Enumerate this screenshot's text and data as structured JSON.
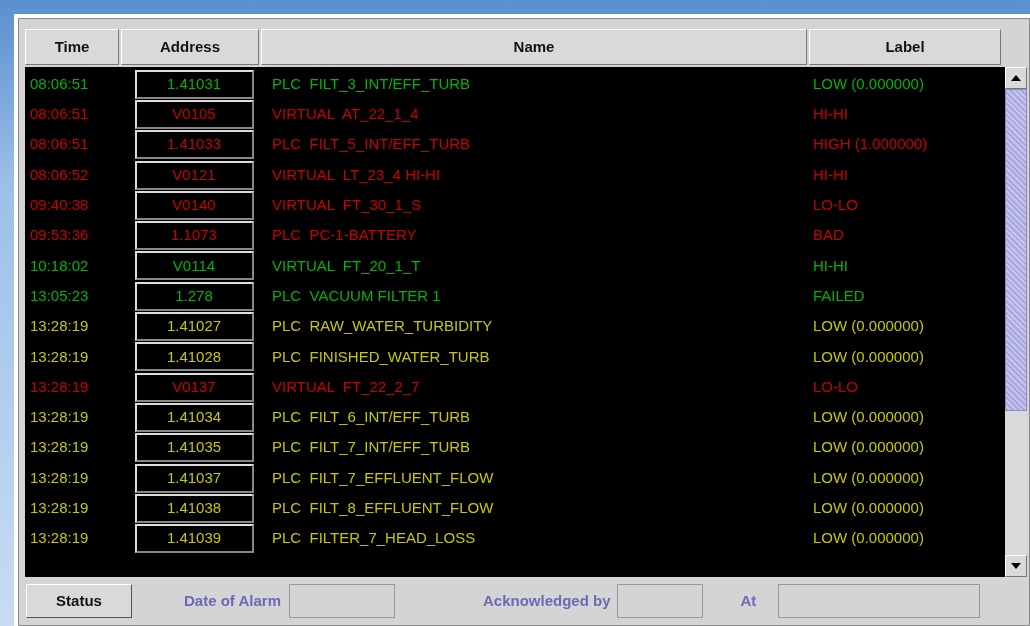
{
  "table": {
    "columns": [
      "Time",
      "Address",
      "Name",
      "Label"
    ],
    "rows": [
      {
        "time": "08:06:51",
        "address": "1.41031",
        "name": "PLC  FILT_3_INT/EFF_TURB",
        "label": "LOW (0.000000)",
        "color": "#00b400"
      },
      {
        "time": "08:06:51",
        "address": "V0105",
        "name": "VIRTUAL  AT_22_1_4",
        "label": "HI-HI",
        "color": "#c80000"
      },
      {
        "time": "08:06:51",
        "address": "1.41033",
        "name": "PLC  FILT_5_INT/EFF_TURB",
        "label": "HIGH (1.000000)",
        "color": "#c80000"
      },
      {
        "time": "08:06:52",
        "address": "V0121",
        "name": "VIRTUAL  LT_23_4 HI-HI",
        "label": "HI-HI",
        "color": "#c80000"
      },
      {
        "time": "09:40:38",
        "address": "V0140",
        "name": "VIRTUAL  FT_30_1_S",
        "label": "LO-LO",
        "color": "#c80000"
      },
      {
        "time": "09:53:36",
        "address": "1.1073",
        "name": "PLC  PC-1-BATTERY",
        "label": "BAD",
        "color": "#c80000"
      },
      {
        "time": "10:18:02",
        "address": "V0114",
        "name": "VIRTUAL  FT_20_1_T",
        "label": "HI-HI",
        "color": "#00b400"
      },
      {
        "time": "13:05:23",
        "address": "1.278",
        "name": "PLC  VACUUM FILTER 1",
        "label": "FAILED",
        "color": "#00b400"
      },
      {
        "time": "13:28:19",
        "address": "1.41027",
        "name": "PLC  RAW_WATER_TURBIDITY",
        "label": "LOW (0.000000)",
        "color": "#c8c800"
      },
      {
        "time": "13:28:19",
        "address": "1.41028",
        "name": "PLC  FINISHED_WATER_TURB",
        "label": "LOW (0.000000)",
        "color": "#c8c800"
      },
      {
        "time": "13:28:19",
        "address": "V0137",
        "name": "VIRTUAL  FT_22_2_7",
        "label": "LO-LO",
        "color": "#c80000"
      },
      {
        "time": "13:28:19",
        "address": "1.41034",
        "name": "PLC  FILT_6_INT/EFF_TURB",
        "label": "LOW (0.000000)",
        "color": "#c8c800"
      },
      {
        "time": "13:28:19",
        "address": "1.41035",
        "name": "PLC  FILT_7_INT/EFF_TURB",
        "label": "LOW (0.000000)",
        "color": "#c8c800"
      },
      {
        "time": "13:28:19",
        "address": "1.41037",
        "name": "PLC  FILT_7_EFFLUENT_FLOW",
        "label": "LOW (0.000000)",
        "color": "#c8c800"
      },
      {
        "time": "13:28:19",
        "address": "1.41038",
        "name": "PLC  FILT_8_EFFLUENT_FLOW",
        "label": "LOW (0.000000)",
        "color": "#c8c800"
      },
      {
        "time": "13:28:19",
        "address": "1.41039",
        "name": "PLC  FILTER_7_HEAD_LOSS",
        "label": "LOW (0.000000)",
        "color": "#c8c800"
      }
    ]
  },
  "footer": {
    "button": "Status",
    "date_label": "Date of Alarm",
    "ack_label": "Acknowledged by",
    "at_label": "At"
  }
}
